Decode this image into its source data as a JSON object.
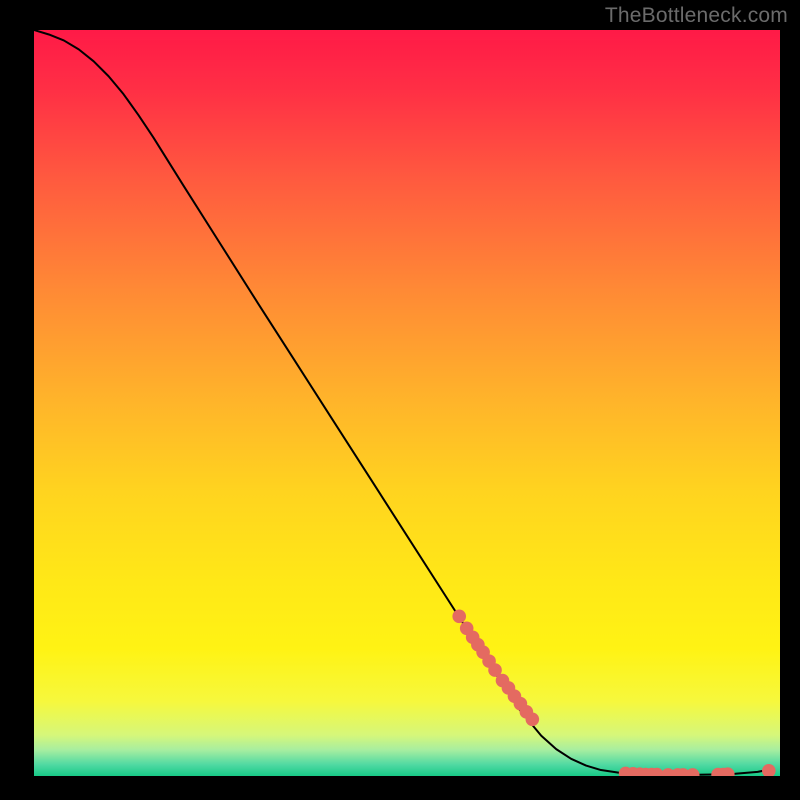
{
  "watermark": "TheBottleneck.com",
  "chart_data": {
    "type": "line",
    "title": "",
    "xlabel": "",
    "ylabel": "",
    "xlim": [
      0,
      100
    ],
    "ylim": [
      0,
      100
    ],
    "grid": false,
    "gradient_stops": [
      {
        "offset": 0.0,
        "color": "#ff1a47"
      },
      {
        "offset": 0.08,
        "color": "#ff2f45"
      },
      {
        "offset": 0.2,
        "color": "#ff5a3f"
      },
      {
        "offset": 0.35,
        "color": "#ff8a35"
      },
      {
        "offset": 0.5,
        "color": "#ffb52a"
      },
      {
        "offset": 0.62,
        "color": "#ffd41f"
      },
      {
        "offset": 0.74,
        "color": "#ffe817"
      },
      {
        "offset": 0.83,
        "color": "#fff314"
      },
      {
        "offset": 0.9,
        "color": "#f6f83d"
      },
      {
        "offset": 0.945,
        "color": "#d6f77a"
      },
      {
        "offset": 0.965,
        "color": "#a7eea0"
      },
      {
        "offset": 0.985,
        "color": "#4fd9a2"
      },
      {
        "offset": 1.0,
        "color": "#18c987"
      }
    ],
    "series": [
      {
        "name": "curve",
        "type": "line",
        "stroke": "#000000",
        "x": [
          0,
          2,
          4,
          6,
          8,
          10,
          12,
          14,
          16,
          20,
          25,
          30,
          35,
          40,
          45,
          50,
          55,
          60,
          65,
          68,
          70,
          72,
          74,
          76,
          79,
          82,
          85,
          88,
          91,
          94,
          97,
          99
        ],
        "y": [
          100,
          99.4,
          98.6,
          97.4,
          95.8,
          93.8,
          91.4,
          88.6,
          85.6,
          79.2,
          71.3,
          63.4,
          55.6,
          47.8,
          40.0,
          32.2,
          24.4,
          16.6,
          9.0,
          5.4,
          3.6,
          2.3,
          1.4,
          0.8,
          0.35,
          0.2,
          0.15,
          0.15,
          0.2,
          0.3,
          0.55,
          0.95
        ]
      },
      {
        "name": "points",
        "type": "scatter",
        "fill": "#e46a61",
        "x": [
          57,
          58,
          58.8,
          59.5,
          60.2,
          61,
          61.8,
          62.8,
          63.6,
          64.4,
          65.2,
          66.0,
          66.8,
          79.3,
          80.3,
          81.2,
          82.0,
          82.8,
          83.5,
          85.0,
          86.3,
          87.0,
          88.3,
          91.7,
          92.4,
          93.0,
          98.5
        ],
        "y": [
          21.4,
          19.8,
          18.6,
          17.6,
          16.6,
          15.4,
          14.2,
          12.8,
          11.8,
          10.7,
          9.7,
          8.6,
          7.6,
          0.35,
          0.3,
          0.25,
          0.2,
          0.2,
          0.2,
          0.15,
          0.15,
          0.15,
          0.15,
          0.2,
          0.2,
          0.25,
          0.7
        ]
      }
    ]
  }
}
